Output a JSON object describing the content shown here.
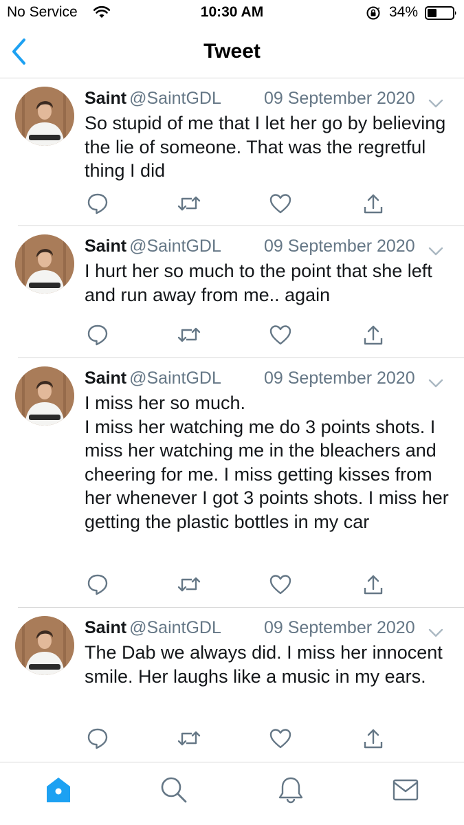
{
  "status_bar": {
    "carrier": "No Service",
    "time": "10:30 AM",
    "battery": "34%"
  },
  "nav": {
    "title": "Tweet",
    "back_icon": "chevron-left-icon"
  },
  "tweets": [
    {
      "name": "Saint",
      "handle": "@SaintGDL",
      "date": "09 September 2020",
      "text": "So stupid of me that I let her go by believing the lie of someone. That was the regretful thing I did"
    },
    {
      "name": "Saint",
      "handle": "@SaintGDL",
      "date": "09 September 2020",
      "text": "I hurt her so much to the point that she left and run away from me.. again"
    },
    {
      "name": "Saint",
      "handle": "@SaintGDL",
      "date": "09 September 2020",
      "text": "I miss her so much.\nI miss her watching me do 3 points shots. I miss her watching me in the bleachers and cheering for me. I miss getting kisses from her whenever I got 3 points shots. I miss her getting the plastic bottles in my car"
    },
    {
      "name": "Saint",
      "handle": "@SaintGDL",
      "date": "09 September 2020",
      "text": "The Dab we always did. I miss her innocent smile. Her laughs like a music in my ears."
    }
  ],
  "tabs": [
    {
      "name": "home",
      "icon": "home-icon",
      "active": true
    },
    {
      "name": "search",
      "icon": "search-icon",
      "active": false
    },
    {
      "name": "notifications",
      "icon": "bell-icon",
      "active": false
    },
    {
      "name": "messages",
      "icon": "mail-icon",
      "active": false
    }
  ],
  "colors": {
    "accent": "#1da1f2",
    "text": "#14171a",
    "secondary": "#657786",
    "icon": "#657786",
    "divider": "#d8d8d8"
  }
}
